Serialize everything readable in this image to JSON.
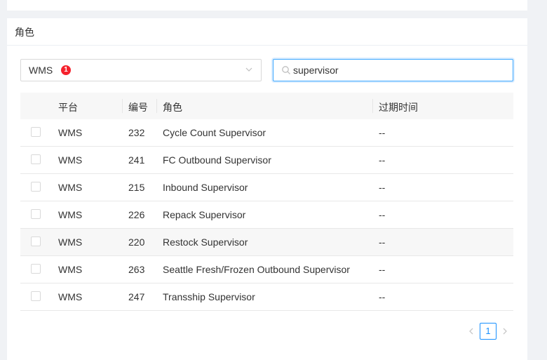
{
  "section": {
    "title": "角色"
  },
  "filter": {
    "platform_value": "WMS",
    "badge_count": "1"
  },
  "search": {
    "value": "supervisor",
    "placeholder": ""
  },
  "table": {
    "headers": {
      "platform": "平台",
      "id": "编号",
      "role": "角色",
      "expire": "过期时间"
    },
    "rows": [
      {
        "platform": "WMS",
        "id": "232",
        "role": "Cycle Count Supervisor",
        "expire": "--"
      },
      {
        "platform": "WMS",
        "id": "241",
        "role": "FC Outbound Supervisor",
        "expire": "--"
      },
      {
        "platform": "WMS",
        "id": "215",
        "role": "Inbound Supervisor",
        "expire": "--"
      },
      {
        "platform": "WMS",
        "id": "226",
        "role": "Repack Supervisor",
        "expire": "--"
      },
      {
        "platform": "WMS",
        "id": "220",
        "role": "Restock Supervisor",
        "expire": "--"
      },
      {
        "platform": "WMS",
        "id": "263",
        "role": "Seattle Fresh/Frozen Outbound Supervisor",
        "expire": "--"
      },
      {
        "platform": "WMS",
        "id": "247",
        "role": "Transship Supervisor",
        "expire": "--"
      }
    ]
  },
  "pagination": {
    "current_page": "1"
  },
  "colors": {
    "accent": "#1890ff",
    "badge": "#f5222d"
  }
}
